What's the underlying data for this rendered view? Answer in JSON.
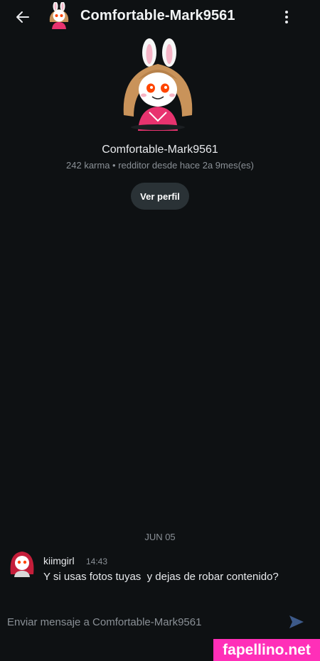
{
  "header": {
    "title": "Comfortable-Mark9561",
    "back_icon": "arrow-left-icon",
    "more_icon": "more-vertical-icon"
  },
  "profile": {
    "username": "Comfortable-Mark9561",
    "meta": "242 karma • redditor desde hace 2a 9mes(es)",
    "view_profile_label": "Ver perfil"
  },
  "conversation": {
    "date_divider": "JUN 05",
    "messages": [
      {
        "author": "kiimgirl",
        "time": "14:43",
        "text": "Y si usas fotos tuyas  y dejas de robar contenido?"
      }
    ]
  },
  "composer": {
    "placeholder": "Enviar mensaje a Comfortable-Mark9561",
    "send_icon": "send-icon"
  },
  "watermark": {
    "text": "fapellino.net"
  },
  "colors": {
    "background": "#0e1113",
    "button_bg": "#2a3236",
    "muted_text": "#8a9096",
    "send_icon": "#3d5a8a",
    "watermark_bg": "#ff2fb8",
    "avatar_pink": "#e8336f",
    "avatar_orange_eye": "#ff4500"
  }
}
